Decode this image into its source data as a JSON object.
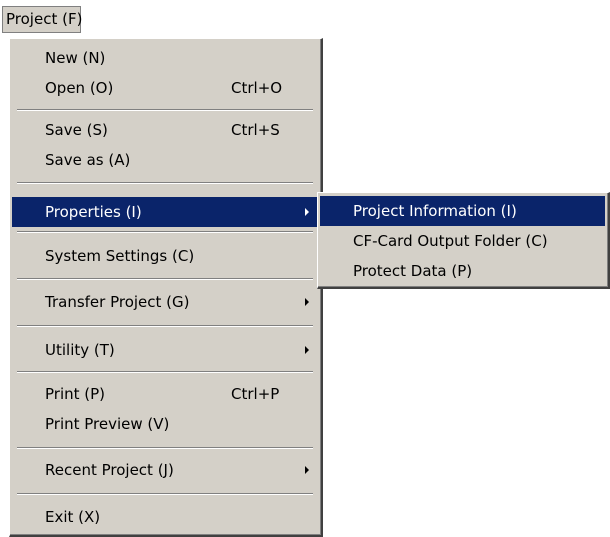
{
  "menubar": {
    "project_label": "Project (F)"
  },
  "colors": {
    "menu_bg": "#d4d0c8",
    "highlight": "#0a246a",
    "highlight_text": "#ffffff"
  },
  "main_menu": {
    "new": {
      "label": "New (N)"
    },
    "open": {
      "label": "Open (O)",
      "shortcut": "Ctrl+O"
    },
    "save": {
      "label": "Save (S)",
      "shortcut": "Ctrl+S"
    },
    "save_as": {
      "label": "Save as (A)"
    },
    "properties": {
      "label": "Properties (I)",
      "highlighted": true,
      "has_submenu": true
    },
    "system_settings": {
      "label": "System Settings (C)"
    },
    "transfer_project": {
      "label": "Transfer Project (G)",
      "has_submenu": true
    },
    "utility": {
      "label": "Utility (T)",
      "has_submenu": true
    },
    "print": {
      "label": "Print (P)",
      "shortcut": "Ctrl+P"
    },
    "print_preview": {
      "label": "Print Preview (V)"
    },
    "recent_project": {
      "label": "Recent Project (J)",
      "has_submenu": true
    },
    "exit": {
      "label": "Exit (X)"
    }
  },
  "submenu": {
    "project_information": {
      "label": "Project Information (I)",
      "highlighted": true
    },
    "cf_card_output_folder": {
      "label": "CF-Card Output Folder (C)"
    },
    "protect_data": {
      "label": "Protect Data (P)"
    }
  }
}
